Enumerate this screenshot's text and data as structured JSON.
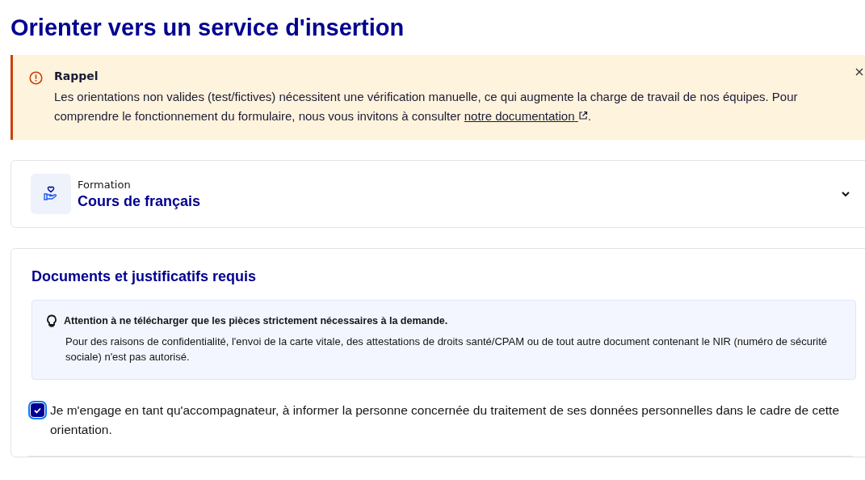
{
  "page_title": "Orienter vers un service d'insertion",
  "alert": {
    "title": "Rappel",
    "text": "Les orientations non valides (test/fictives) nécessitent une vérification manuelle, ce qui augmente la charge de travail de nos équipes. Pour comprendre le fonctionnement du formulaire, nous vous invitons à consulter",
    "link": "notre documentation",
    "after": "."
  },
  "service": {
    "category": "Formation",
    "name": "Cours de français",
    "expanded": false
  },
  "documents": {
    "title": "Documents et justificatifs requis",
    "notice_title": "Attention à ne télécharger que les pièces strictement nécessaires à la demande.",
    "notice_text": "Pour des raisons de confidentialité, l'envoi de la carte vitale, des attestations de droits santé/CPAM ou de tout autre document contenant le NIR (numéro de sécurité sociale) n'est pas autorisé.",
    "consent": {
      "label": "Je m'engage en tant qu'accompagnateur, à informer la personne concernée du traitement de ses données personnelles dans le cadre de cette orientation.",
      "checked": true
    }
  }
}
